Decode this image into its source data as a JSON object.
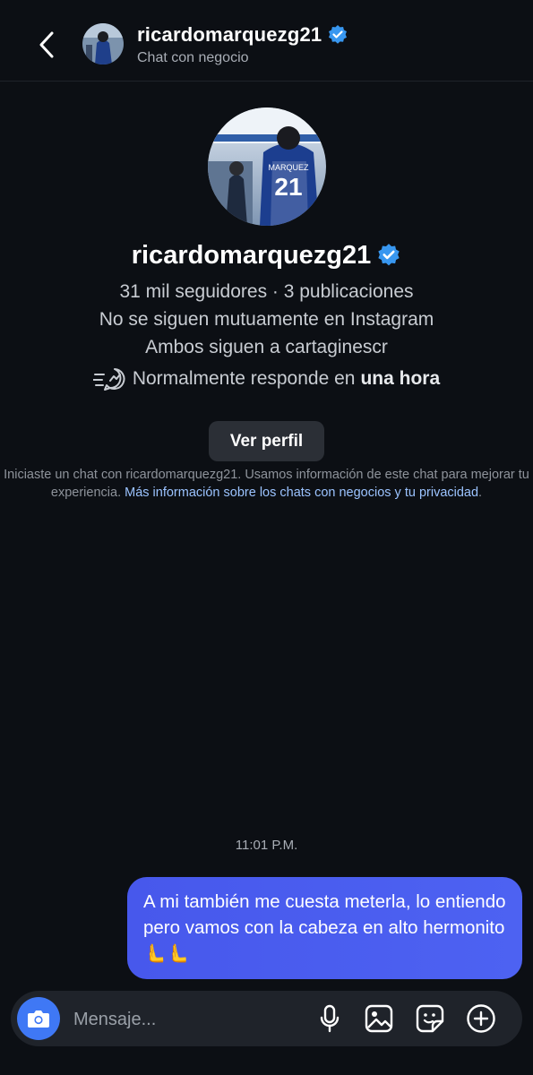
{
  "header": {
    "username": "ricardomarquezg21",
    "subtitle": "Chat con negocio"
  },
  "profile": {
    "username": "ricardomarquezg21",
    "stats": "31 mil seguidores · 3 publicaciones",
    "mutual": "No se siguen mutuamente en Instagram",
    "common": "Ambos siguen a cartaginescr",
    "response_prefix": "Normalmente responde en",
    "response_time": "una hora",
    "view_profile": "Ver perfil"
  },
  "notice": {
    "text": "Iniciaste un chat con ricardomarquezg21. Usamos información de este chat para mejorar tu experiencia.",
    "link": "Más información sobre los chats con negocios y tu privacidad",
    "end": "."
  },
  "conversation": {
    "timestamp": "11:01 P.M.",
    "messages": [
      {
        "text": "A mi también me cuesta meterla, lo entiendo pero vamos con la cabeza en alto hermonito 🫷🫷"
      }
    ]
  },
  "composer": {
    "placeholder": "Mensaje..."
  },
  "icons": {
    "back": "chevron-left-icon",
    "verified": "verified-badge-icon",
    "response": "fast-response-icon",
    "camera": "camera-icon",
    "mic": "microphone-icon",
    "gallery": "gallery-icon",
    "sticker": "sticker-icon",
    "plus": "plus-icon"
  },
  "colors": {
    "background": "#0c0f14",
    "bubble": "#4a5cf0",
    "verified": "#3897f0",
    "link": "#9bc3ff",
    "camera_button": "#3f78f5"
  }
}
